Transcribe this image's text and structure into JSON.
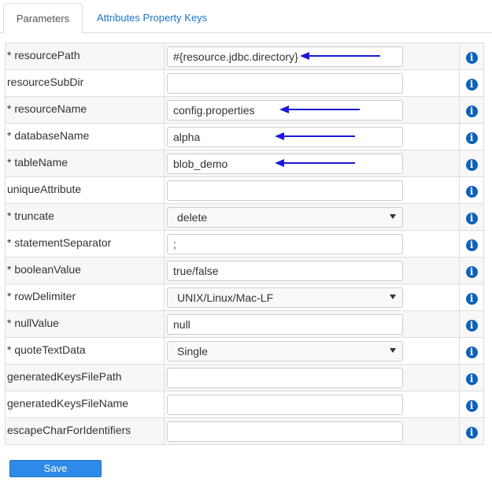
{
  "tabs": [
    {
      "label": "Parameters"
    },
    {
      "label": "Attributes Property Keys"
    }
  ],
  "info_icon": "info-circle-icon",
  "accent_color": "#1a74c9",
  "arrow_color": "#1a1ad6",
  "rows": [
    {
      "label": "* resourcePath",
      "value": "#{resource.jdbc.directory}"
    },
    {
      "label": "resourceSubDir",
      "value": ""
    },
    {
      "label": "* resourceName",
      "value": "config.properties"
    },
    {
      "label": "* databaseName",
      "value": "alpha"
    },
    {
      "label": "* tableName",
      "value": "blob_demo"
    },
    {
      "label": "uniqueAttribute",
      "value": ""
    },
    {
      "label": "* truncate",
      "value": "delete"
    },
    {
      "label": "* statementSeparator",
      "value": ";"
    },
    {
      "label": "* booleanValue",
      "value": "true/false"
    },
    {
      "label": "* rowDelimiter",
      "value": "UNIX/Linux/Mac-LF"
    },
    {
      "label": "* nullValue",
      "value": "null"
    },
    {
      "label": "* quoteTextData",
      "value": "Single"
    },
    {
      "label": "generatedKeysFilePath",
      "value": ""
    },
    {
      "label": "generatedKeysFileName",
      "value": ""
    },
    {
      "label": "escapeCharForIdentifiers",
      "value": ""
    }
  ],
  "save_label": "Save"
}
